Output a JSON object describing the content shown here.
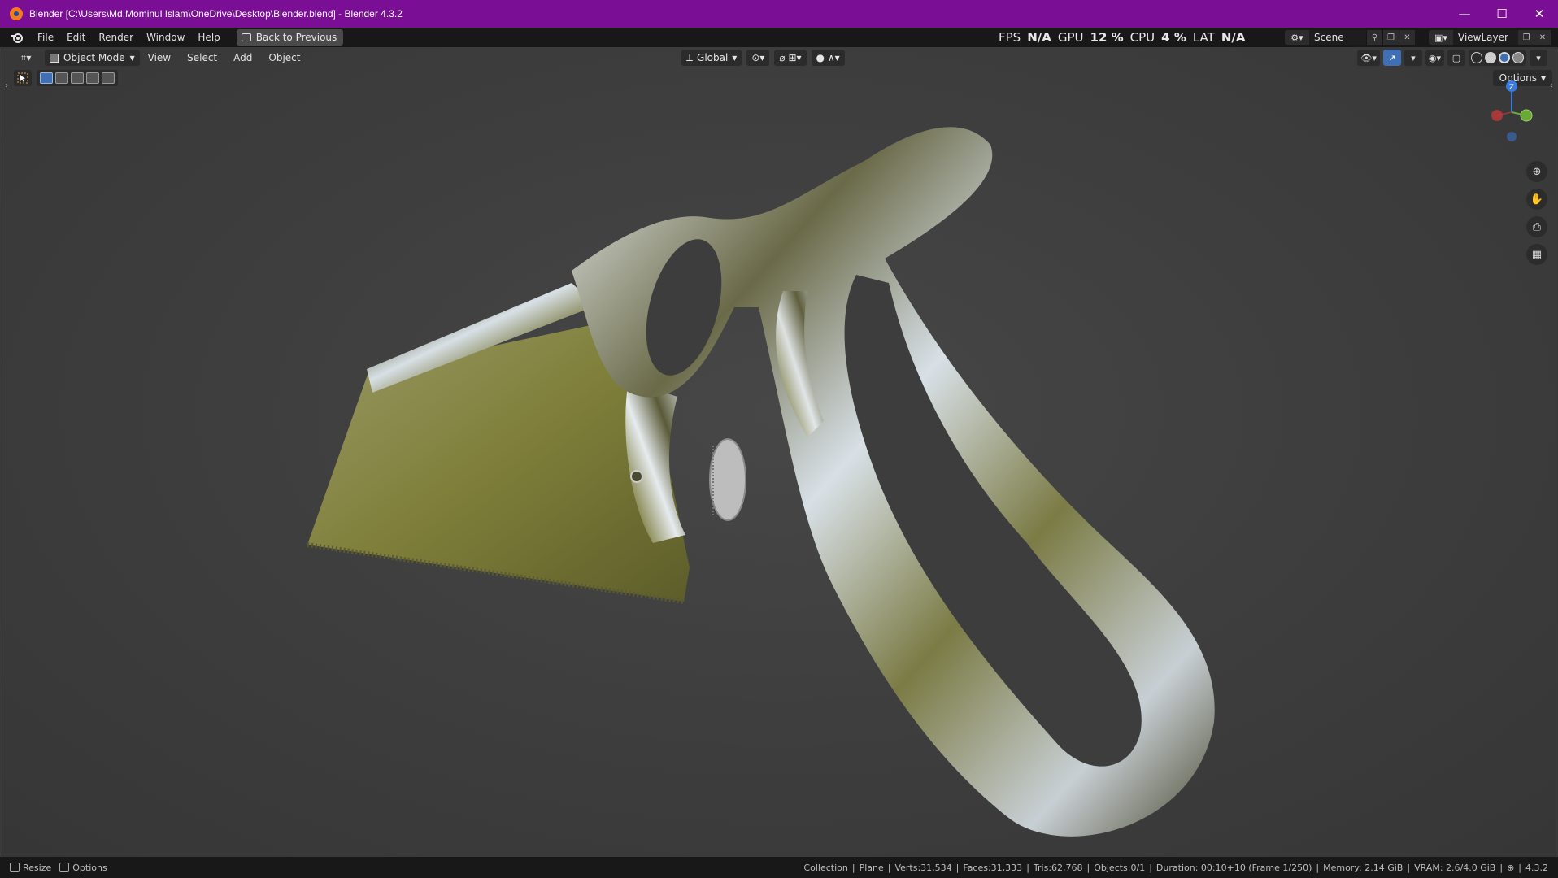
{
  "window": {
    "title": "Blender [C:\\Users\\Md.Mominul Islam\\OneDrive\\Desktop\\Blender.blend] - Blender 4.3.2",
    "minimize": "—",
    "maximize": "☐",
    "close": "✕"
  },
  "topbar": {
    "menus": [
      "File",
      "Edit",
      "Render",
      "Window",
      "Help"
    ],
    "back_button": "Back to Previous",
    "perf": {
      "fps_label": "FPS",
      "fps_value": "N/A",
      "gpu_label": "GPU",
      "gpu_value": "12 %",
      "cpu_label": "CPU",
      "cpu_value": "4 %",
      "lat_label": "LAT",
      "lat_value": "N/A"
    },
    "scene": "Scene",
    "view_layer": "ViewLayer"
  },
  "viewport": {
    "mode": "Object Mode",
    "menus": [
      "View",
      "Select",
      "Add",
      "Object"
    ],
    "orientation": "Global",
    "options_label": "Options",
    "gizmo": {
      "z": "Z",
      "colors": {
        "x": "#d2393a",
        "y": "#6aa837",
        "z": "#3a7be0"
      }
    }
  },
  "status": {
    "left_items": [
      "Resize",
      "Options"
    ],
    "collection": "Collection",
    "object": "Plane",
    "verts": "Verts:31,534",
    "faces": "Faces:31,333",
    "tris": "Tris:62,768",
    "objects": "Objects:0/1",
    "duration": "Duration: 00:10+10 (Frame 1/250)",
    "memory": "Memory: 2.14 GiB",
    "vram": "VRAM: 2.6/4.0 GiB",
    "version": "4.3.2"
  },
  "colors": {
    "titlebar": "#7a0f95",
    "accent": "#3f6fb5"
  }
}
